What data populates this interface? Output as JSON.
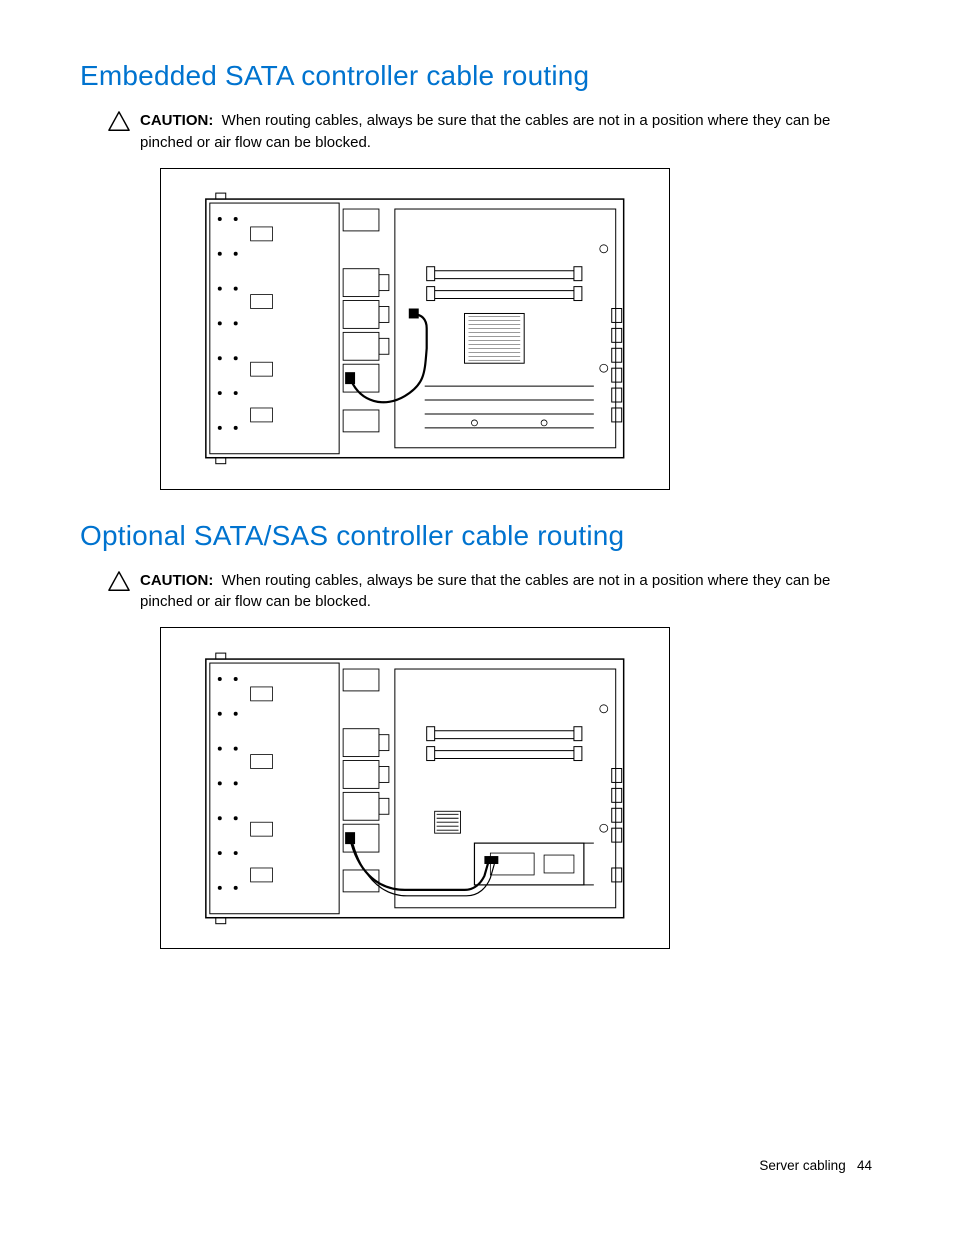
{
  "section1": {
    "heading": "Embedded SATA controller cable routing",
    "caution_label": "CAUTION:",
    "caution_text": "When routing cables, always be sure that the cables are not in a position where they can be pinched or air flow can be blocked."
  },
  "section2": {
    "heading": "Optional SATA/SAS controller cable routing",
    "caution_label": "CAUTION:",
    "caution_text": "When routing cables, always be sure that the cables are not in a position where they can be pinched or air flow can be blocked."
  },
  "footer": {
    "chapter": "Server cabling",
    "page_number": "44"
  }
}
